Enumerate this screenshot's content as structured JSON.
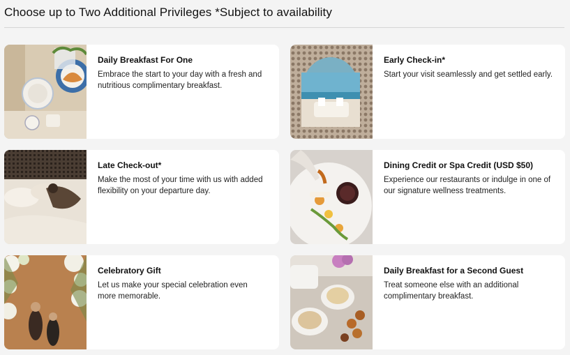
{
  "header": {
    "title": "Choose up to Two Additional Privileges *Subject to availability"
  },
  "cards": [
    {
      "title": "Daily Breakfast For One",
      "desc": "Embrace the start to your day with a fresh and nutritious complimentary breakfast."
    },
    {
      "title": "Early Check-in*",
      "desc": "Start your visit seamlessly and get settled early."
    },
    {
      "title": "Late Check-out*",
      "desc": "Make the most of your time with us with added flexibility on your departure day."
    },
    {
      "title": "Dining Credit or Spa Credit (USD $50)",
      "desc": "Experience our restaurants or indulge in one of our signature wellness treatments."
    },
    {
      "title": "Celebratory Gift",
      "desc": "Let us make your special celebration even more memorable."
    },
    {
      "title": "Daily Breakfast for a Second Guest",
      "desc": "Treat someone else with an additional complimentary breakfast."
    }
  ]
}
